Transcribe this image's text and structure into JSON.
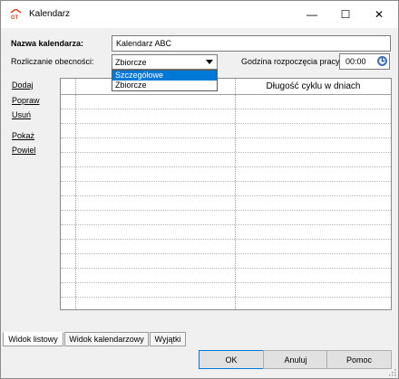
{
  "window": {
    "title": "Kalendarz",
    "minimize_glyph": "—",
    "maximize_glyph": "☐",
    "close_glyph": "✕"
  },
  "form": {
    "name_label": "Nazwa kalendarza:",
    "name_value": "Kalendarz ABC",
    "attendance_label": "Rozliczanie obecności:",
    "attendance_value": "Zbiorcze",
    "attendance_options": [
      "Szczegółowe",
      "Zbiorcze"
    ],
    "highlighted_option": "Szczegółowe",
    "start_time_label": "Godzina rozpoczęcia pracy:",
    "start_time_value": "00:00"
  },
  "side_links": {
    "add": "Dodaj",
    "edit": "Popraw",
    "delete": "Usuń",
    "show": "Pokaż",
    "repeat": "Powiel"
  },
  "grid": {
    "column_header": "Długość cyklu w dniach"
  },
  "tabs": [
    "Widok listowy",
    "Widok kalendarzowy",
    "Wyjątki"
  ],
  "active_tab": "Widok listowy",
  "buttons": {
    "ok": "OK",
    "cancel": "Anuluj",
    "help": "Pomoc"
  },
  "colors": {
    "selection": "#0078d7",
    "dialog_bg": "#f0f0f0"
  }
}
